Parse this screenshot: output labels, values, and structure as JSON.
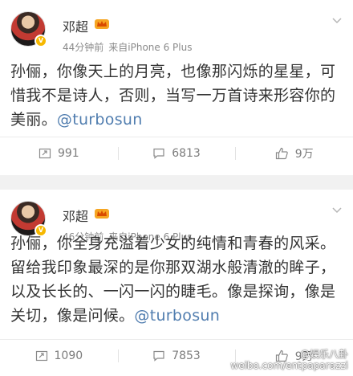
{
  "posts": [
    {
      "author": "邓超",
      "time": "44分钟前",
      "source": "来自iPhone 6 Plus",
      "text": "孙俪，你像天上的月亮，也像那闪烁的星星，可惜我不是诗人，否则，当写一万首诗来形容你的美丽。",
      "mention": "@turbosun",
      "reposts": "991",
      "comments": "6813",
      "likes": "9万"
    },
    {
      "author": "邓超",
      "time": "46分钟前",
      "source": "来自iPhone 6 Plus",
      "text": "孙俪，你全身充溢着少女的纯情和青春的风采。留给我印象最深的是你那双湖水般清澈的眸子，以及长长的、一闪一闪的睫毛。像是探询，像是关切，像是问候。",
      "mention": "@turbosun",
      "reposts": "1090",
      "comments": "7853",
      "likes": "9万"
    }
  ],
  "watermark": {
    "handle": "@娱乐八卦",
    "site": "weibo.com/entpaparazzi"
  },
  "colors": {
    "mention": "#507daf",
    "badge": "#f6b800"
  }
}
